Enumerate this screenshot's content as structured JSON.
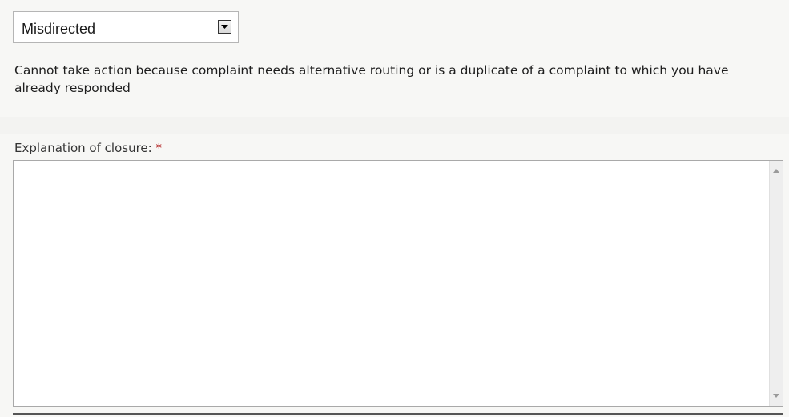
{
  "closure_reason": {
    "selected": "Misdirected",
    "dropdown_icon": "chevron-down-icon"
  },
  "description": "Cannot take action because complaint needs alternative routing or is a duplicate of a complaint to which you have already responded",
  "explanation": {
    "label": "Explanation of closure:",
    "required_marker": "*",
    "value": "",
    "scroll_up_icon": "scroll-up-arrow-icon",
    "scroll_down_icon": "scroll-down-arrow-icon"
  },
  "colors": {
    "required": "#b22222",
    "background": "#f7f7f5"
  }
}
